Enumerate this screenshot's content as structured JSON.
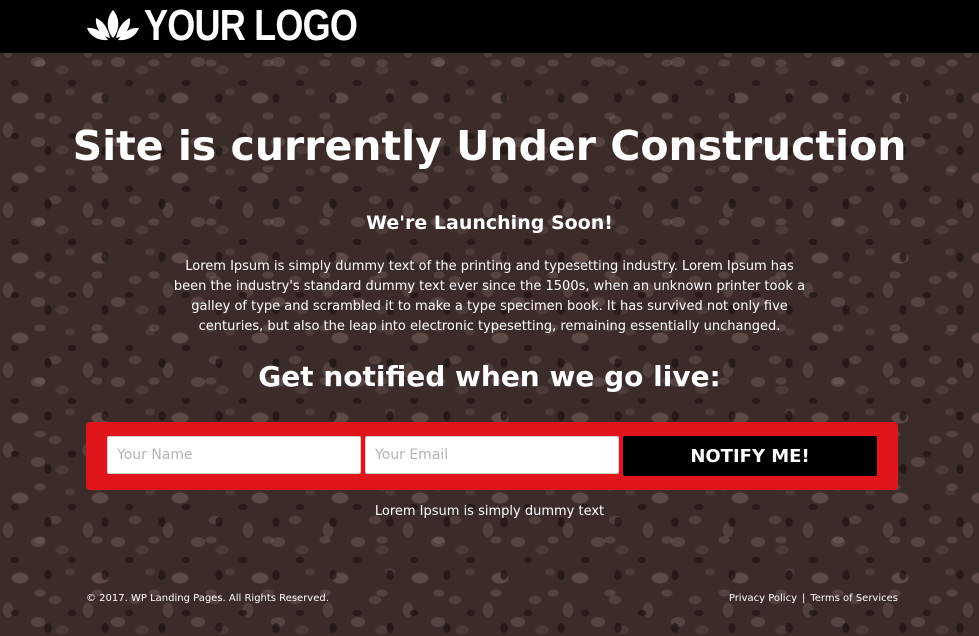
{
  "header": {
    "logo_icon": "lotus-icon",
    "logo_text": "YOUR LOGO"
  },
  "main": {
    "title": "Site is currently Under Construction",
    "subtitle": "We're Launching Soon!",
    "description": "Lorem Ipsum is simply dummy text of the printing and typesetting industry. Lorem Ipsum has been the industry's standard dummy text ever since the 1500s, when an unknown printer took a galley of type and scrambled it to make a type specimen book. It has survived not only five centuries, but also the leap into electronic typesetting, remaining essentially unchanged.",
    "notify_heading": "Get notified when we go live:"
  },
  "form": {
    "name_placeholder": "Your Name",
    "email_placeholder": "Your Email",
    "button_label": "NOTIFY ME!",
    "note": "Lorem Ipsum is simply dummy text"
  },
  "footer": {
    "copyright": "© 2017. WP Landing Pages. All Rights Reserved.",
    "privacy_link": "Privacy Policy",
    "separator": "|",
    "terms_link": "Terms of Services"
  },
  "colors": {
    "header_bg": "#000000",
    "form_bg": "#e0161c",
    "button_bg": "#000000",
    "text": "#ffffff"
  }
}
